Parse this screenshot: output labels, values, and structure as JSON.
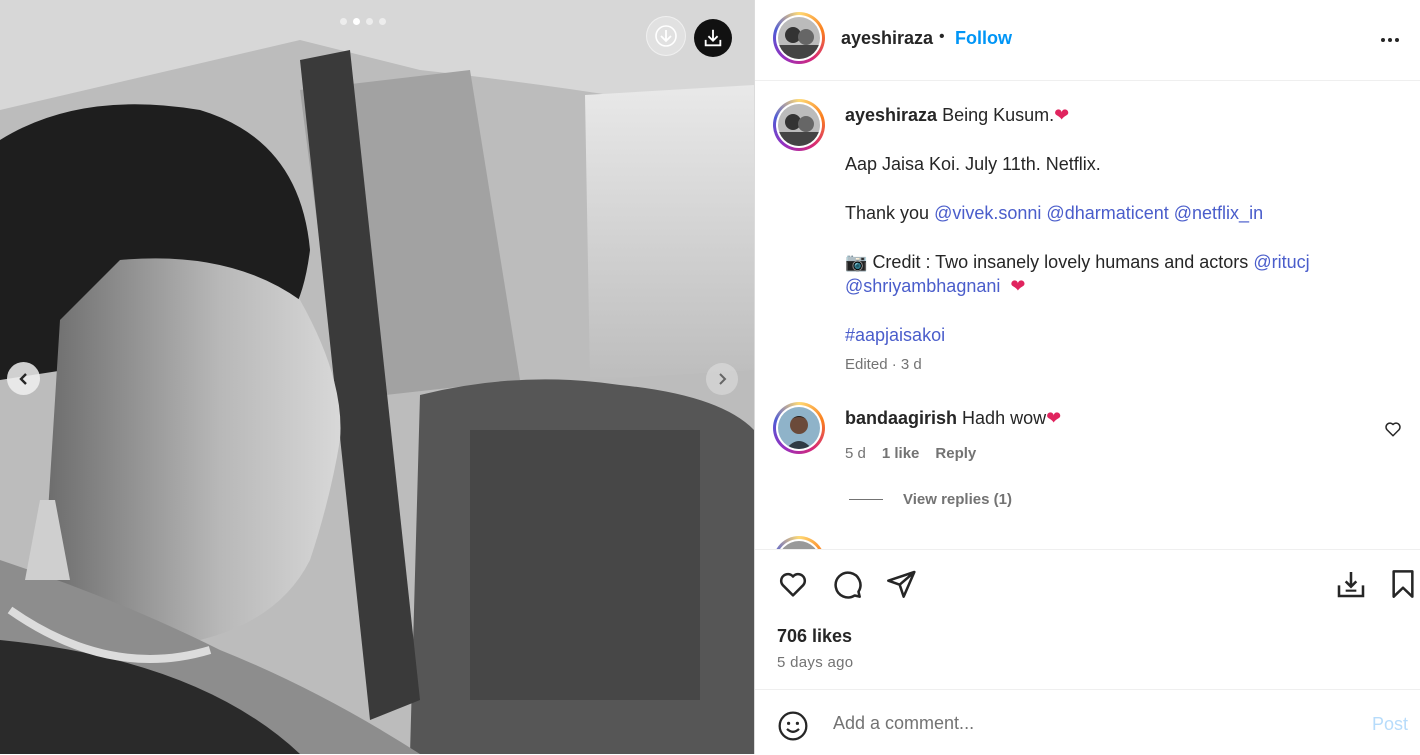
{
  "post": {
    "author": "ayeshiraza",
    "follow_label": "Follow",
    "separator": "•",
    "caption_lines": [
      "Being Kusum.",
      "Aap Jaisa Koi. July 11th. Netflix.",
      "Thank you",
      "Credit : Two insanely lovely humans and actors"
    ],
    "mentions_line": [
      "@vivek.sonni",
      "@dharmaticent",
      "@netflix_in"
    ],
    "credit_mentions": [
      "@ritucj",
      "@shriyambhagnani"
    ],
    "hashtag": "#aapjaisakoi",
    "caption_meta": "Edited · 3 d",
    "likes": "706 likes",
    "posted": "5 days ago"
  },
  "comments": [
    {
      "user": "bandaagirish",
      "text": "Hadh wow",
      "age": "5 d",
      "likes": "1 like",
      "reply_label": "Reply",
      "view_replies": "View replies (1)"
    }
  ],
  "composer": {
    "placeholder": "Add a comment...",
    "post_label": "Post"
  },
  "carousel": {
    "total": 4,
    "active": 2
  },
  "colors": {
    "accent": "#0095f6",
    "mention": "#4a5dcb",
    "heart": "#e0245e"
  },
  "icons": [
    "download-icon",
    "chevron-left-icon",
    "chevron-right-icon",
    "more-icon",
    "heart-icon",
    "comment-icon",
    "share-icon",
    "save-to-collection-icon",
    "bookmark-icon",
    "emoji-icon",
    "camera-emoji-icon"
  ]
}
